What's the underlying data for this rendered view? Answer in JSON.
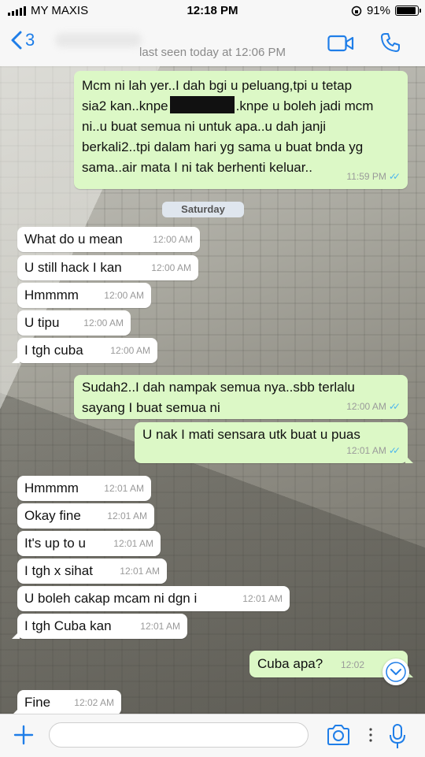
{
  "status_bar": {
    "carrier": "MY MAXIS",
    "time": "12:18 PM",
    "battery": "91%"
  },
  "header": {
    "back_count": "3",
    "last_seen": "last seen today at 12:06 PM"
  },
  "day_badge": "Saturday",
  "messages": [
    {
      "dir": "out",
      "lines": [
        "Mcm ni lah yer..I dah bgi u peluang,tpi u tetap",
        "sia2 kan..knpe",
        ".knpe u boleh jadi mcm",
        "ni..u buat semua ni untuk apa..u dah janji",
        "berkali2..tpi dalam hari yg sama u buat bnda yg",
        "sama..air mata I ni tak berhenti keluar.."
      ],
      "time": "11:59 PM"
    },
    {
      "dir": "in",
      "text": "What do u mean",
      "time": "12:00 AM"
    },
    {
      "dir": "in",
      "text": "U still hack I kan",
      "time": "12:00 AM"
    },
    {
      "dir": "in",
      "text": "Hmmmm",
      "time": "12:00 AM"
    },
    {
      "dir": "in",
      "text": "U tipu",
      "time": "12:00 AM"
    },
    {
      "dir": "in",
      "text": "I tgh cuba",
      "time": "12:00 AM"
    },
    {
      "dir": "out",
      "lines": [
        "Sudah2..I dah nampak semua nya..sbb terlalu",
        "sayang I buat semua ni"
      ],
      "time": "12:00 AM"
    },
    {
      "dir": "out",
      "text": "U nak I mati sensara utk buat u puas",
      "time": "12:01 AM"
    },
    {
      "dir": "in",
      "text": "Hmmmm",
      "time": "12:01 AM"
    },
    {
      "dir": "in",
      "text": "Okay fine",
      "time": "12:01 AM"
    },
    {
      "dir": "in",
      "text": "It's up to u",
      "time": "12:01 AM"
    },
    {
      "dir": "in",
      "text": "I tgh x sihat",
      "time": "12:01 AM"
    },
    {
      "dir": "in",
      "text": "U boleh cakap mcam ni dgn i",
      "time": "12:01 AM"
    },
    {
      "dir": "in",
      "text": "I tgh Cuba kan",
      "time": "12:01 AM"
    },
    {
      "dir": "out",
      "text": "Cuba apa?",
      "time": "12:02"
    },
    {
      "dir": "in",
      "text": "Fine",
      "time": "12:02 AM"
    }
  ],
  "icons": {
    "back": "chevron-left-icon",
    "video": "video-call-icon",
    "phone": "phone-icon",
    "plus": "plus-icon",
    "camera": "camera-icon",
    "mic": "microphone-icon",
    "scroll": "chevron-down-icon",
    "read": "double-check-icon"
  },
  "colors": {
    "accent": "#1f7ee8",
    "outgoing": "#dcf8c6",
    "incoming": "#ffffff",
    "read_ticks": "#4fb6ec"
  }
}
